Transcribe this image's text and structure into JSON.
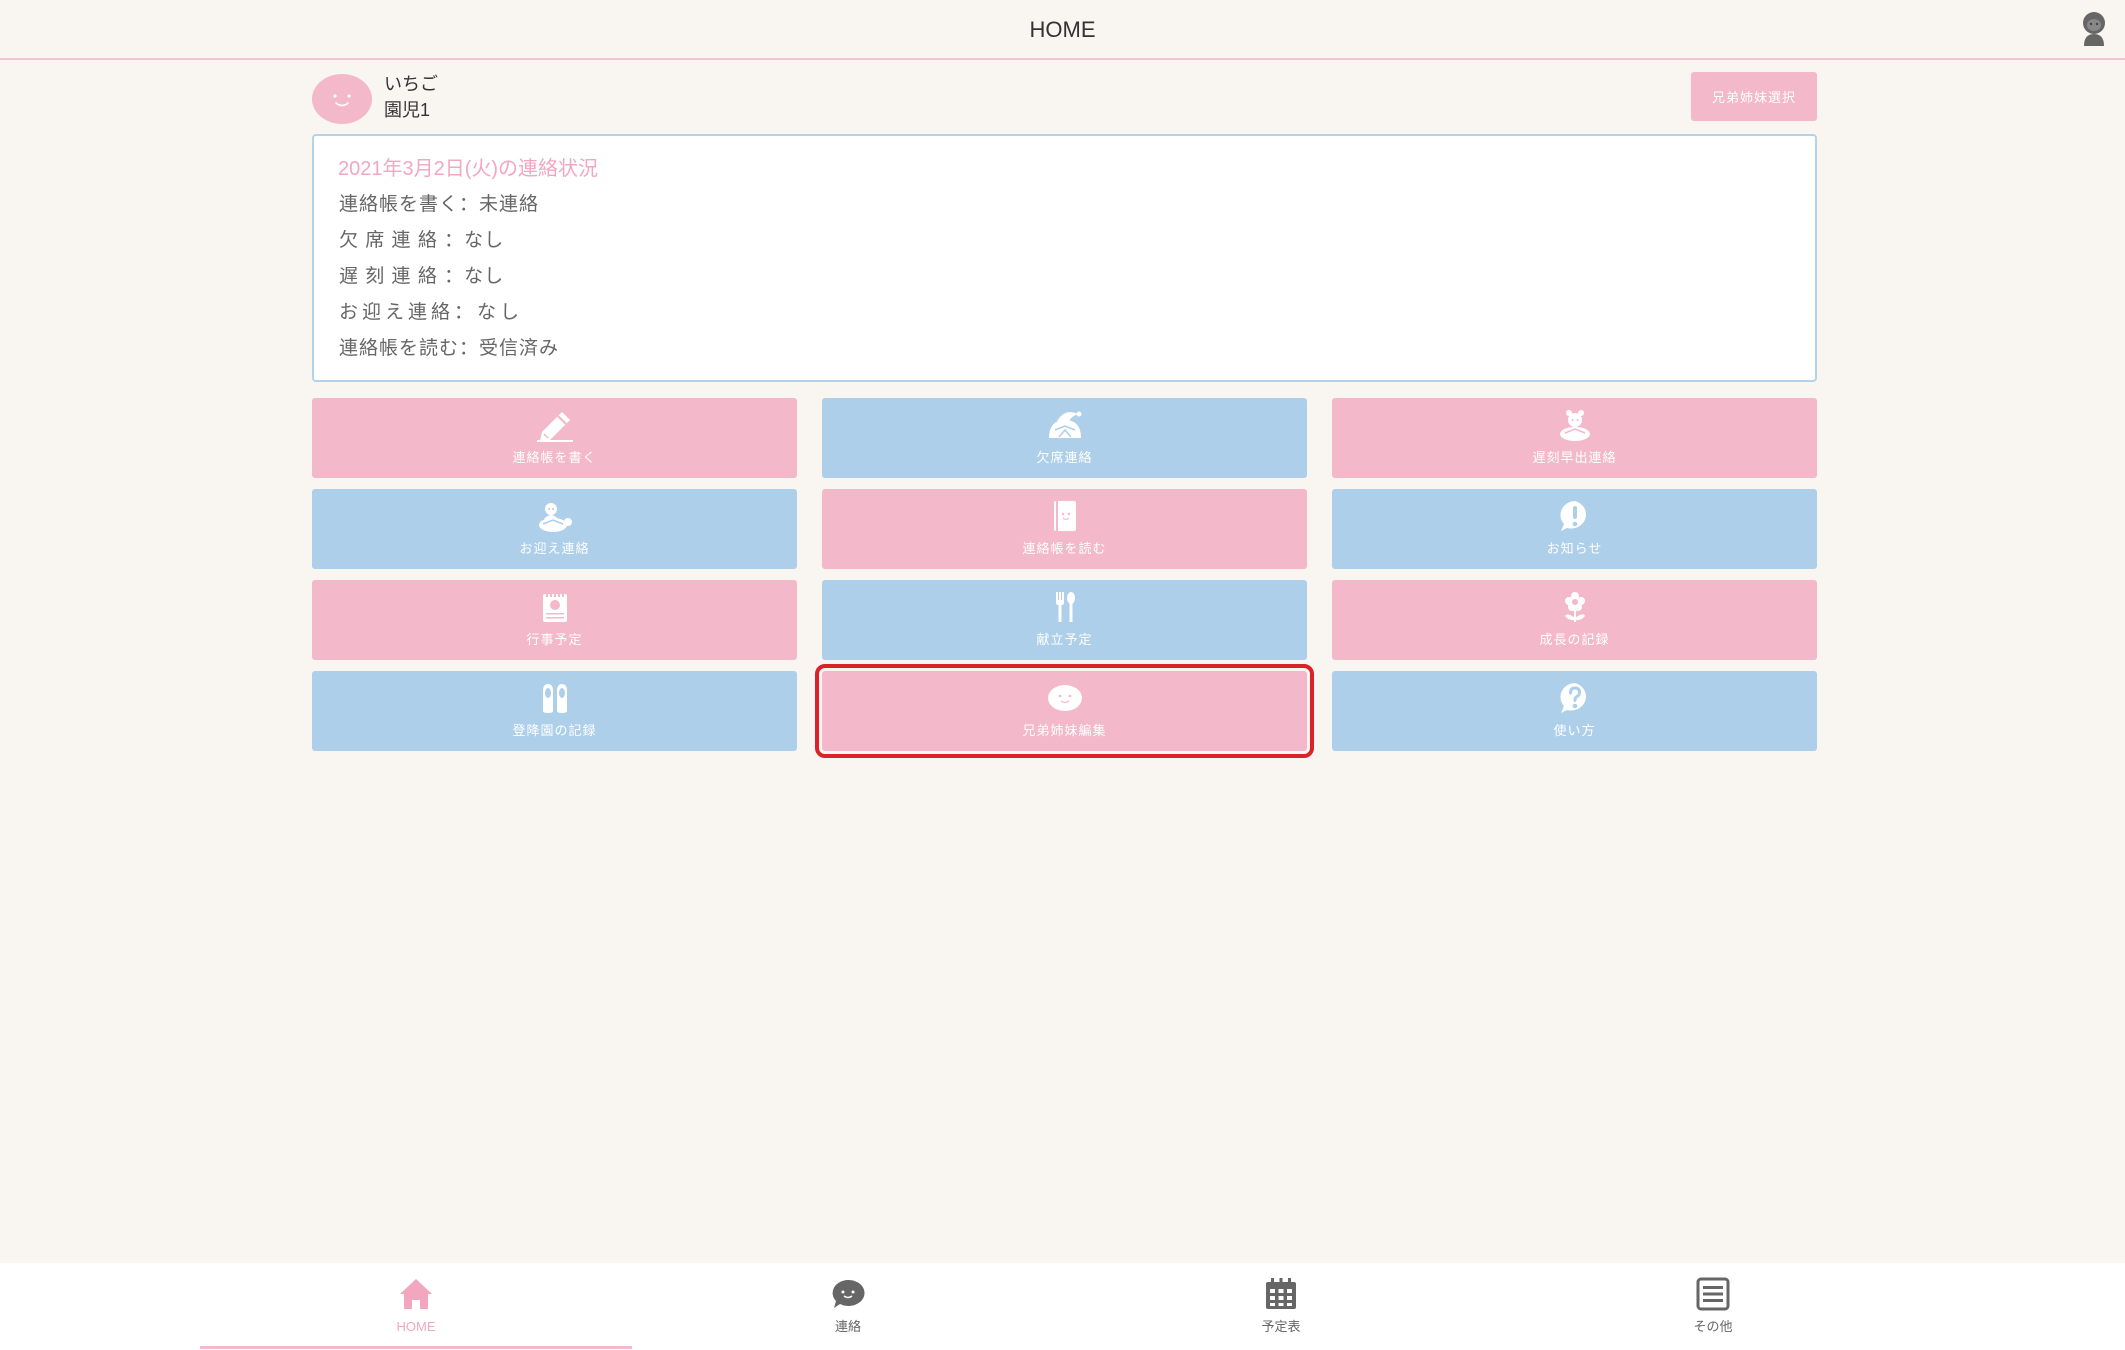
{
  "header": {
    "title": "HOME",
    "avatar_icon": "user-avatar-icon"
  },
  "child": {
    "name": "いちご",
    "class_label": "園児1",
    "avatar_icon": "smile-face-icon"
  },
  "sibling_select": {
    "label": "兄弟姉妹選択"
  },
  "status": {
    "title": "2021年3月2日(火)の連絡状況",
    "lines": [
      "連絡帳を書く：未連絡",
      "欠 席 連 絡 ：なし",
      "遅 刻 連 絡 ：なし",
      "お迎え連絡：なし",
      "連絡帳を読む：受信済み"
    ]
  },
  "menu": [
    {
      "label": "連絡帳を書く",
      "icon": "pencil-icon",
      "color": "pink"
    },
    {
      "label": "欠席連絡",
      "icon": "sleeping-turtle-icon",
      "color": "blue"
    },
    {
      "label": "遅刻早出連絡",
      "icon": "bear-turtle-icon",
      "color": "pink"
    },
    {
      "label": "お迎え連絡",
      "icon": "turtle-pickup-icon",
      "color": "blue"
    },
    {
      "label": "連絡帳を読む",
      "icon": "notebook-icon",
      "color": "pink"
    },
    {
      "label": "お知らせ",
      "icon": "exclamation-icon",
      "color": "blue"
    },
    {
      "label": "行事予定",
      "icon": "calendar-icon",
      "color": "pink"
    },
    {
      "label": "献立予定",
      "icon": "fork-spoon-icon",
      "color": "blue"
    },
    {
      "label": "成長の記録",
      "icon": "flower-icon",
      "color": "pink"
    },
    {
      "label": "登降園の記録",
      "icon": "shoes-icon",
      "color": "blue"
    },
    {
      "label": "兄弟姉妹編集",
      "icon": "smile-face-icon",
      "color": "pink",
      "selected": true
    },
    {
      "label": "使い方",
      "icon": "question-icon",
      "color": "blue"
    }
  ],
  "nav": [
    {
      "label": "HOME",
      "icon": "home-icon",
      "active": true
    },
    {
      "label": "連絡",
      "icon": "chat-icon",
      "active": false
    },
    {
      "label": "予定表",
      "icon": "calendar-grid-icon",
      "active": false
    },
    {
      "label": "その他",
      "icon": "menu-list-icon",
      "active": false
    }
  ],
  "colors": {
    "background": "#f9f6f2",
    "pink": "#f4b8cb",
    "blue": "#aecfea",
    "accent": "#f3a7bf",
    "highlight": "#d9222a",
    "status_border": "#b2d3ea"
  }
}
